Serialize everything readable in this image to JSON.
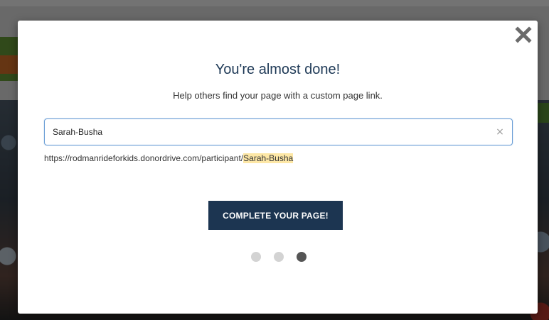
{
  "modal": {
    "title": "You're almost done!",
    "subtitle": "Help others find your page with a custom page link.",
    "close_icon": "close-icon",
    "url_input": {
      "value": "Sarah-Busha",
      "clear_symbol": "×"
    },
    "url_preview": {
      "base": "https://rodmanrideforkids.donordrive.com/participant/",
      "slug": "Sarah-Busha"
    },
    "cta_label": "COMPLETE YOUR PAGE!",
    "steps": {
      "total": 3,
      "current": 3
    }
  },
  "colors": {
    "title": "#1f3a57",
    "cta_background": "#1c3551",
    "slug_highlight": "#fde7a6",
    "step_active": "#555555",
    "step_inactive": "#d3d3d3"
  }
}
